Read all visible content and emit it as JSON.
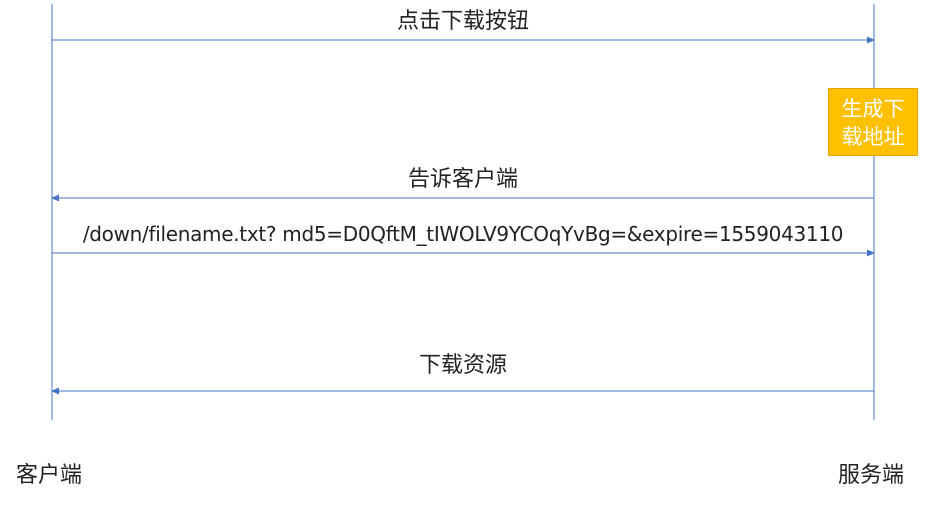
{
  "colors": {
    "line": "#4472c4",
    "box_fill": "#ffc000",
    "box_text": "#ffffff",
    "text": "#222222"
  },
  "actors": {
    "client": "客户端",
    "server": "服务端"
  },
  "process": {
    "label": "生成下\n载地址"
  },
  "messages": [
    {
      "label": "点击下载按钮",
      "direction": "client-to-server"
    },
    {
      "label": "告诉客户端",
      "direction": "server-to-client"
    },
    {
      "label": "/down/filename.txt? md5=D0QftM_tIWOLV9YCOqYvBg=&expire=1559043110",
      "direction": "client-to-server"
    },
    {
      "label": "下载资源",
      "direction": "server-to-client"
    }
  ]
}
